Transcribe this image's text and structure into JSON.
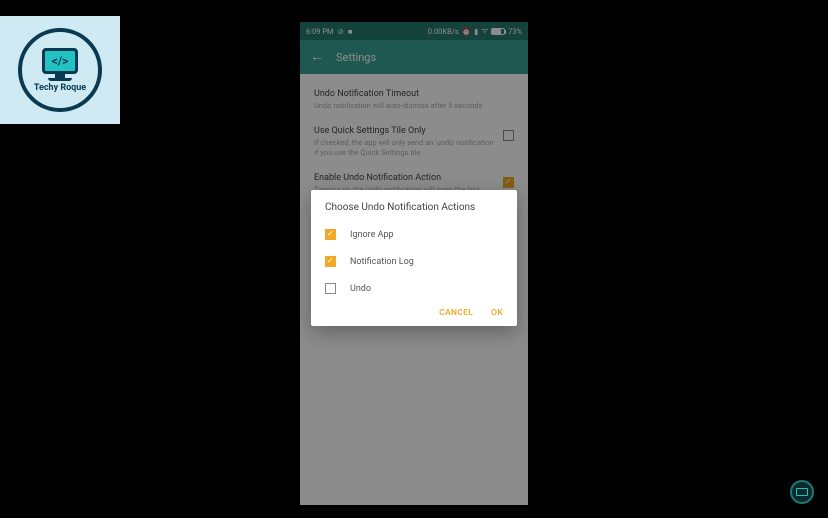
{
  "watermark": {
    "name": "Techy Roque",
    "code": "</>"
  },
  "status": {
    "time": "6:09 PM",
    "speed": "0.00KB/s",
    "battery": "73%"
  },
  "appbar": {
    "title": "Settings"
  },
  "settings": {
    "items": [
      {
        "title": "Undo Notification Timeout",
        "sub": "Undo notification will auto-dismiss after 5 seconds",
        "has_check": false,
        "checked": false
      },
      {
        "title": "Use Quick Settings Tile Only",
        "sub": "If checked, the app will only send an 'undo' notification if you use the Quick Settings tile",
        "has_check": true,
        "checked": false
      },
      {
        "title": "Enable Undo Notification Action",
        "sub": "Tapping on the undo notification will open the last",
        "has_check": true,
        "checked": true
      }
    ]
  },
  "dialog": {
    "title": "Choose Undo Notification Actions",
    "options": [
      {
        "label": "Ignore App",
        "checked": true
      },
      {
        "label": "Notification Log",
        "checked": true
      },
      {
        "label": "Undo",
        "checked": false
      }
    ],
    "cancel": "CANCEL",
    "ok": "OK"
  }
}
